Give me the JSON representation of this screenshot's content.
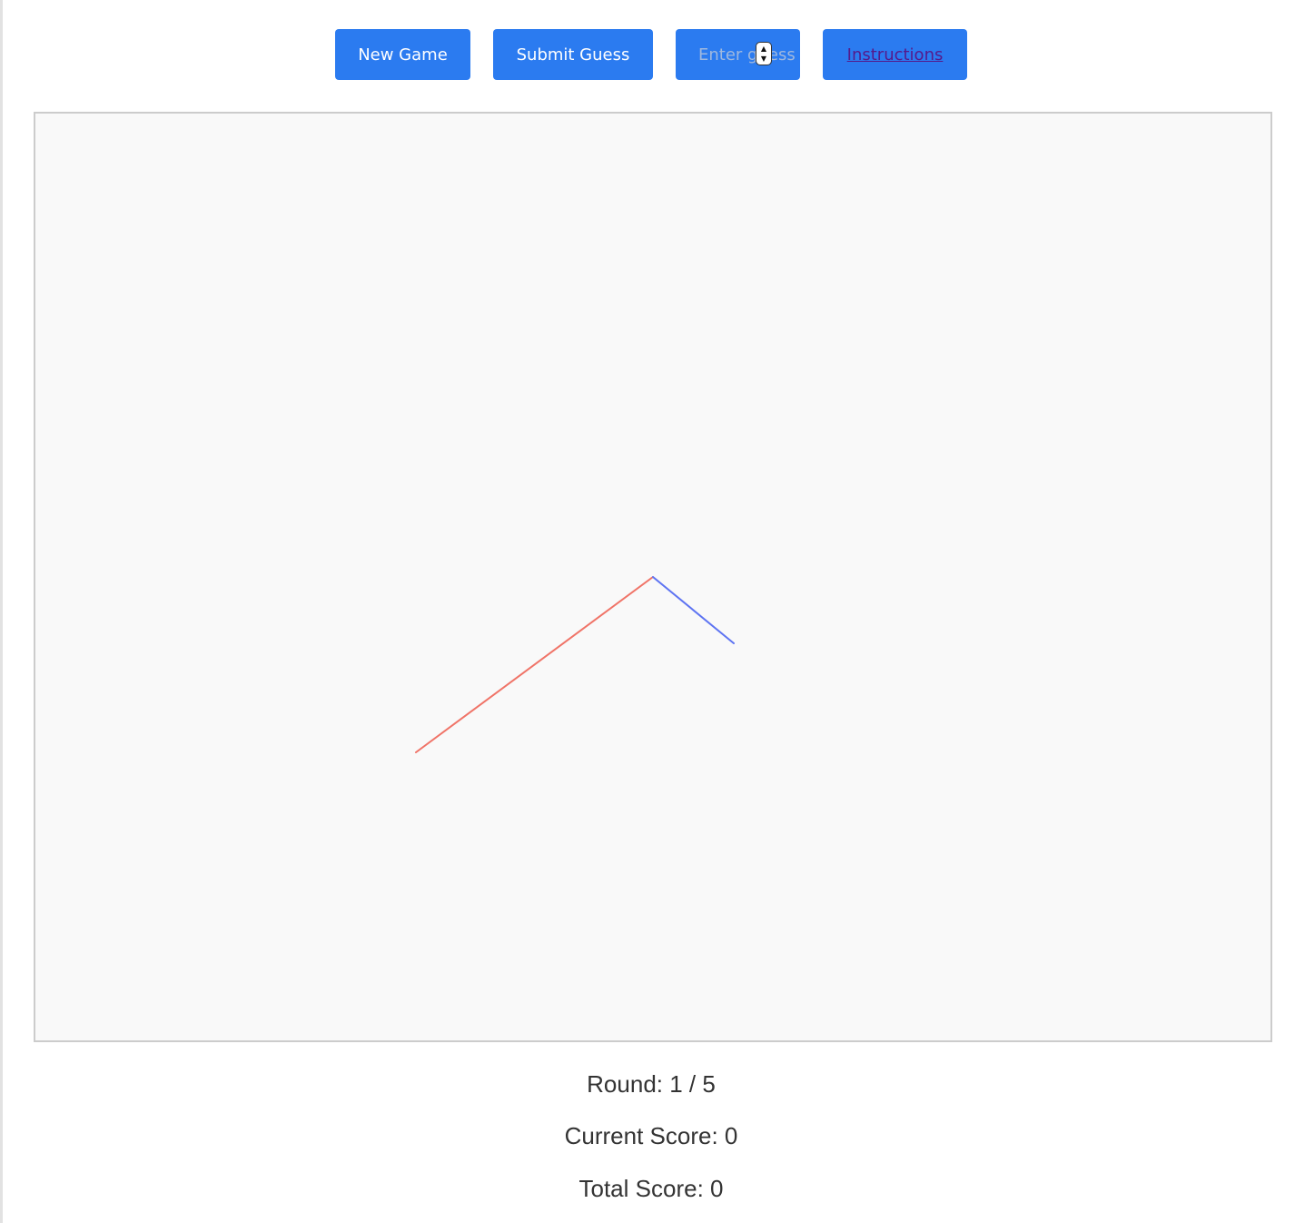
{
  "controls": {
    "new_game_label": "New Game",
    "submit_label": "Submit Guess",
    "guess_placeholder": "Enter guess",
    "guess_value": "",
    "instructions_label": "Instructions"
  },
  "colors": {
    "button": "#2b7bf0",
    "line_a": "#f07468",
    "line_b": "#5e74f2",
    "board_bg": "#f9f9f9"
  },
  "status": {
    "round_label": "Round:",
    "round_value": "1 / 5",
    "current_label": "Current Score:",
    "current_value": "0",
    "total_label": "Total Score:",
    "total_value": "0"
  }
}
